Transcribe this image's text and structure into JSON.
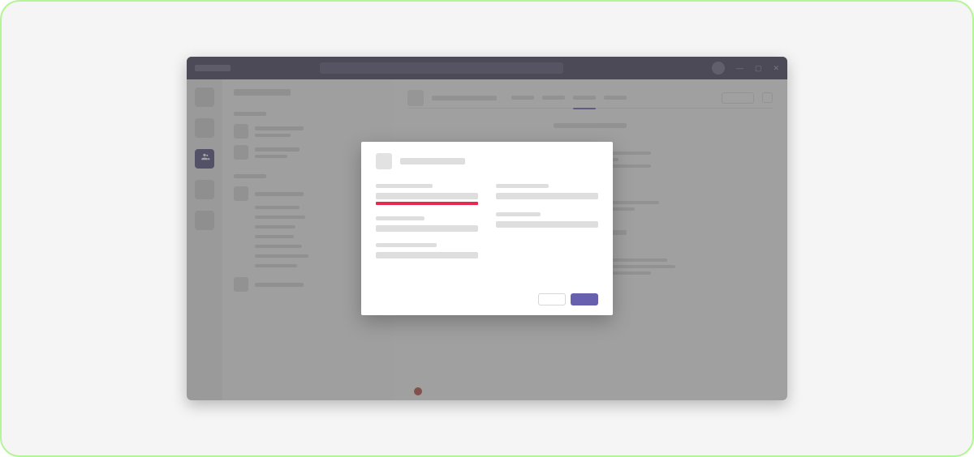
{
  "colors": {
    "accent_purple": "#6660af",
    "titlebar": "#3c3853",
    "error_red": "#e7294f",
    "frame_border": "#b6f49a"
  },
  "window": {
    "title_placeholder": "",
    "search_placeholder": "",
    "controls": {
      "minimize": "—",
      "maximize": "▢",
      "close": "✕"
    }
  },
  "rail": {
    "items": [
      {
        "name": "activity",
        "active": false
      },
      {
        "name": "chat",
        "active": false
      },
      {
        "name": "teams",
        "active": true
      },
      {
        "name": "calendar",
        "active": false
      },
      {
        "name": "files",
        "active": false
      }
    ]
  },
  "sidebar": {
    "title": "",
    "sections": [
      {
        "heading": "",
        "items": [
          "",
          ""
        ]
      },
      {
        "heading": "",
        "items": [
          "",
          "",
          "",
          "",
          "",
          "",
          "",
          "",
          ""
        ]
      }
    ]
  },
  "content": {
    "channel_name": "",
    "tabs": [
      "",
      "",
      "",
      ""
    ],
    "active_tab_index": 2,
    "action_label": ""
  },
  "modal": {
    "title": "",
    "left_fields": [
      {
        "label": "",
        "value": "",
        "error": true
      },
      {
        "label": "",
        "value": ""
      },
      {
        "label": "",
        "value": ""
      }
    ],
    "right_fields": [
      {
        "label": "",
        "value": ""
      },
      {
        "label": "",
        "value": ""
      }
    ],
    "buttons": {
      "cancel": "",
      "confirm": ""
    }
  }
}
